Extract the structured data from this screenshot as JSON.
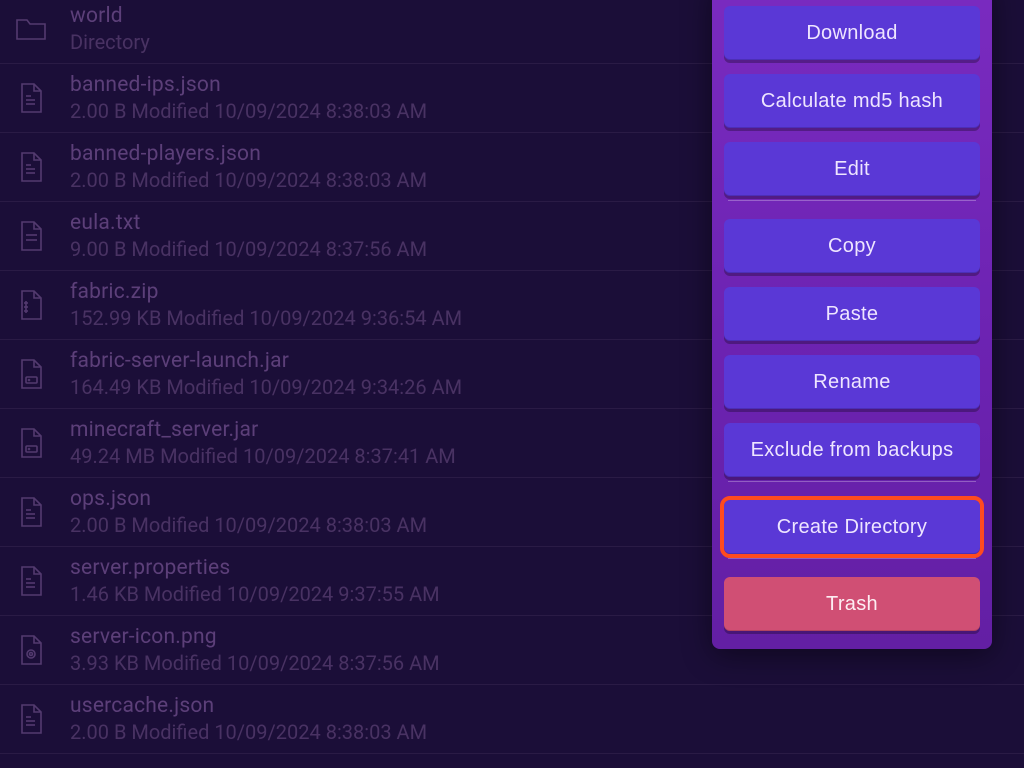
{
  "files": [
    {
      "name": "world",
      "meta": "Directory",
      "icon": "folder"
    },
    {
      "name": "banned-ips.json",
      "meta": "2.00 B Modified 10/09/2024 8:38:03 AM",
      "icon": "json"
    },
    {
      "name": "banned-players.json",
      "meta": "2.00 B Modified 10/09/2024 8:38:03 AM",
      "icon": "json"
    },
    {
      "name": "eula.txt",
      "meta": "9.00 B Modified 10/09/2024 8:37:56 AM",
      "icon": "txt"
    },
    {
      "name": "fabric.zip",
      "meta": "152.99 KB Modified 10/09/2024 9:36:54 AM",
      "icon": "zip"
    },
    {
      "name": "fabric-server-launch.jar",
      "meta": "164.49 KB Modified 10/09/2024 9:34:26 AM",
      "icon": "jar"
    },
    {
      "name": "minecraft_server.jar",
      "meta": "49.24 MB Modified 10/09/2024 8:37:41 AM",
      "icon": "jar"
    },
    {
      "name": "ops.json",
      "meta": "2.00 B Modified 10/09/2024 8:38:03 AM",
      "icon": "json"
    },
    {
      "name": "server.properties",
      "meta": "1.46 KB Modified 10/09/2024 9:37:55 AM",
      "icon": "json"
    },
    {
      "name": "server-icon.png",
      "meta": "3.93 KB Modified 10/09/2024 8:37:56 AM",
      "icon": "png"
    },
    {
      "name": "usercache.json",
      "meta": "2.00 B Modified 10/09/2024 8:38:03 AM",
      "icon": "json"
    }
  ],
  "menu": {
    "download": "Download",
    "md5": "Calculate md5 hash",
    "edit": "Edit",
    "copy": "Copy",
    "paste": "Paste",
    "rename": "Rename",
    "exclude": "Exclude from backups",
    "create_dir": "Create Directory",
    "trash": "Trash"
  }
}
